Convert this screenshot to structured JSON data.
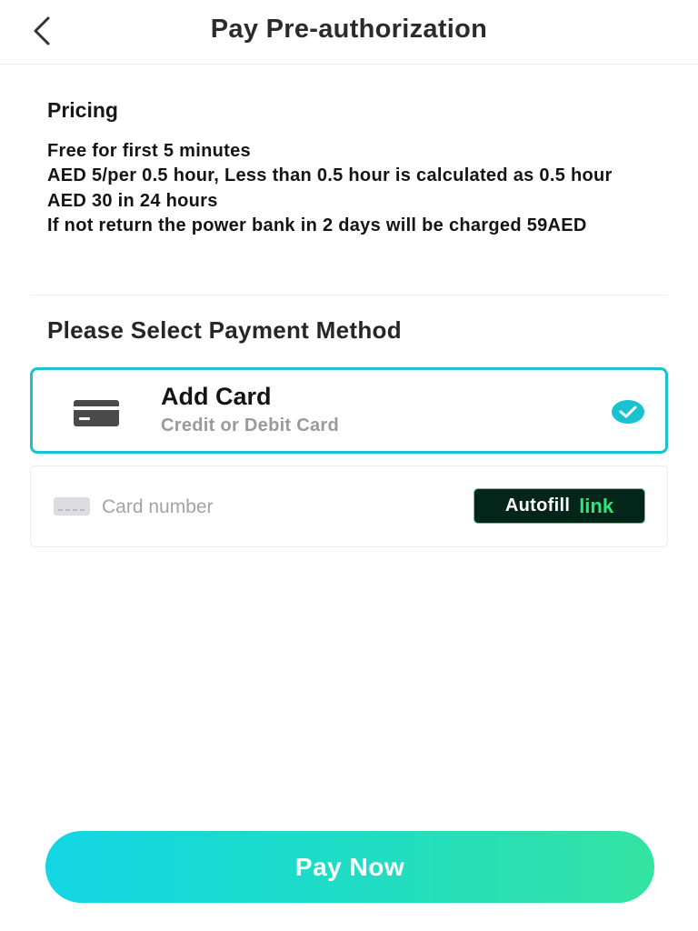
{
  "header": {
    "title": "Pay Pre-authorization",
    "back_icon": "chevron-left-icon"
  },
  "pricing": {
    "heading": "Pricing",
    "lines": [
      "Free for first 5 minutes",
      "AED 5/per 0.5 hour, Less than 0.5 hour is calculated as 0.5 hour",
      "AED 30 in 24 hours",
      "If not return the power bank in 2 days will be charged 59AED"
    ]
  },
  "payment": {
    "heading": "Please Select Payment Method",
    "option": {
      "title": "Add Card",
      "subtitle": "Credit or Debit Card",
      "icon": "credit-card-icon",
      "selected": true
    },
    "card_field": {
      "placeholder": "Card number",
      "value": ""
    },
    "autofill": {
      "label": "Autofill",
      "brand": "link"
    }
  },
  "colors": {
    "accent": "#19c2cf",
    "autofill_bg": "#04261a",
    "link_green": "#2ee57a"
  },
  "footer": {
    "pay_label": "Pay Now"
  }
}
